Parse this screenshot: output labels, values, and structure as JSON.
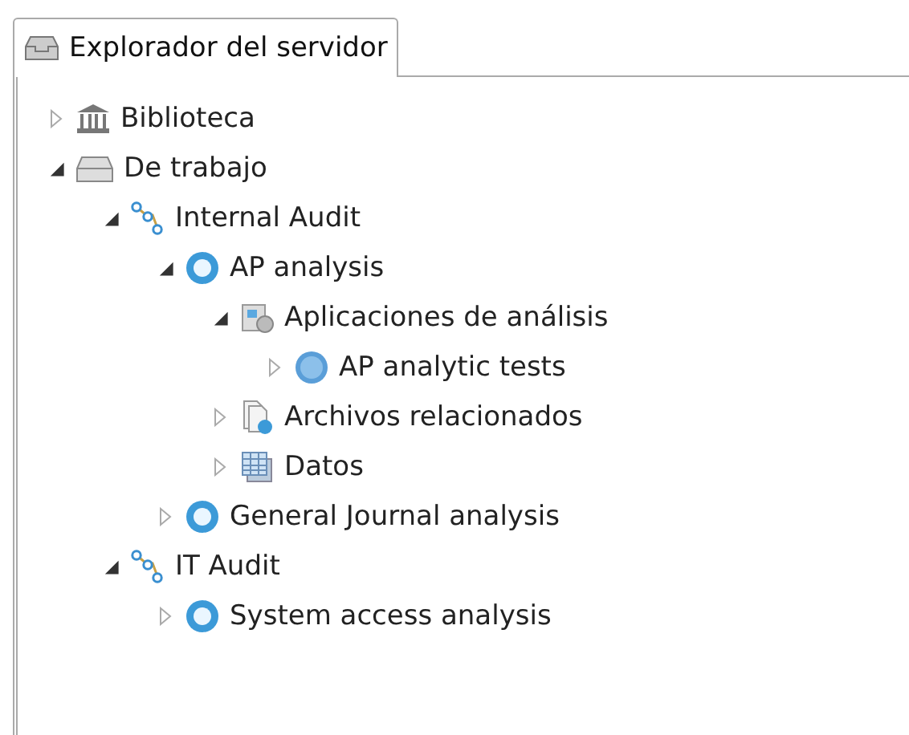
{
  "tab": {
    "title": "Explorador del servidor",
    "selected": true
  },
  "tree": [
    {
      "label": "Biblioteca",
      "kind": "library",
      "expanded": false
    },
    {
      "label": "De trabajo",
      "kind": "drawer",
      "expanded": true,
      "children": [
        {
          "label": "Internal Audit",
          "kind": "project",
          "expanded": true,
          "children": [
            {
              "label": "AP analysis",
              "kind": "analysis",
              "expanded": true,
              "children": [
                {
                  "label": "Aplicaciones de análisis",
                  "kind": "apps",
                  "expanded": true,
                  "children": [
                    {
                      "label": "AP analytic tests",
                      "kind": "acl",
                      "expanded": false
                    }
                  ]
                },
                {
                  "label": "Archivos relacionados",
                  "kind": "files",
                  "expanded": false
                },
                {
                  "label": "Datos",
                  "kind": "data",
                  "expanded": false
                }
              ]
            },
            {
              "label": "General Journal analysis",
              "kind": "analysis",
              "expanded": false
            }
          ]
        },
        {
          "label": "IT Audit",
          "kind": "project",
          "expanded": true,
          "children": [
            {
              "label": "System access analysis",
              "kind": "analysis",
              "expanded": false
            }
          ]
        }
      ]
    }
  ]
}
